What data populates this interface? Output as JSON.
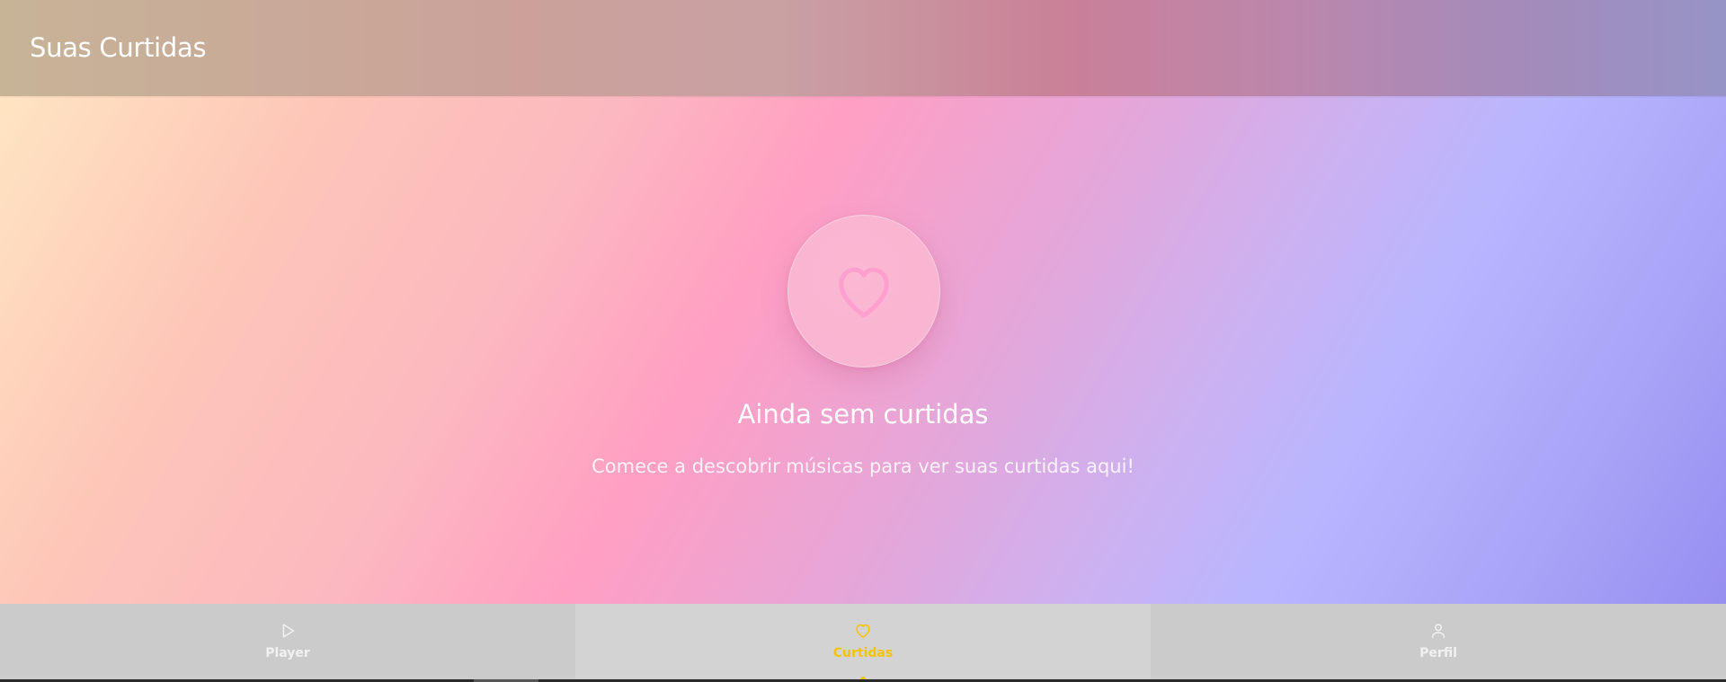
{
  "header": {
    "title": "Suas Curtidas"
  },
  "empty_state": {
    "icon": "heart-icon",
    "title": "Ainda sem curtidas",
    "subtitle": "Comece a descobrir músicas para ver suas curtidas aqui!"
  },
  "nav": {
    "tabs": [
      {
        "label": "Player",
        "icon": "play-icon",
        "active": false
      },
      {
        "label": "Curtidas",
        "icon": "heart-icon",
        "active": true
      },
      {
        "label": "Perfil",
        "icon": "user-icon",
        "active": false
      }
    ]
  },
  "colors": {
    "accent": "#f5c400",
    "nav_background": "#cbcbcb",
    "heart_stroke": "#ff9fd0"
  }
}
